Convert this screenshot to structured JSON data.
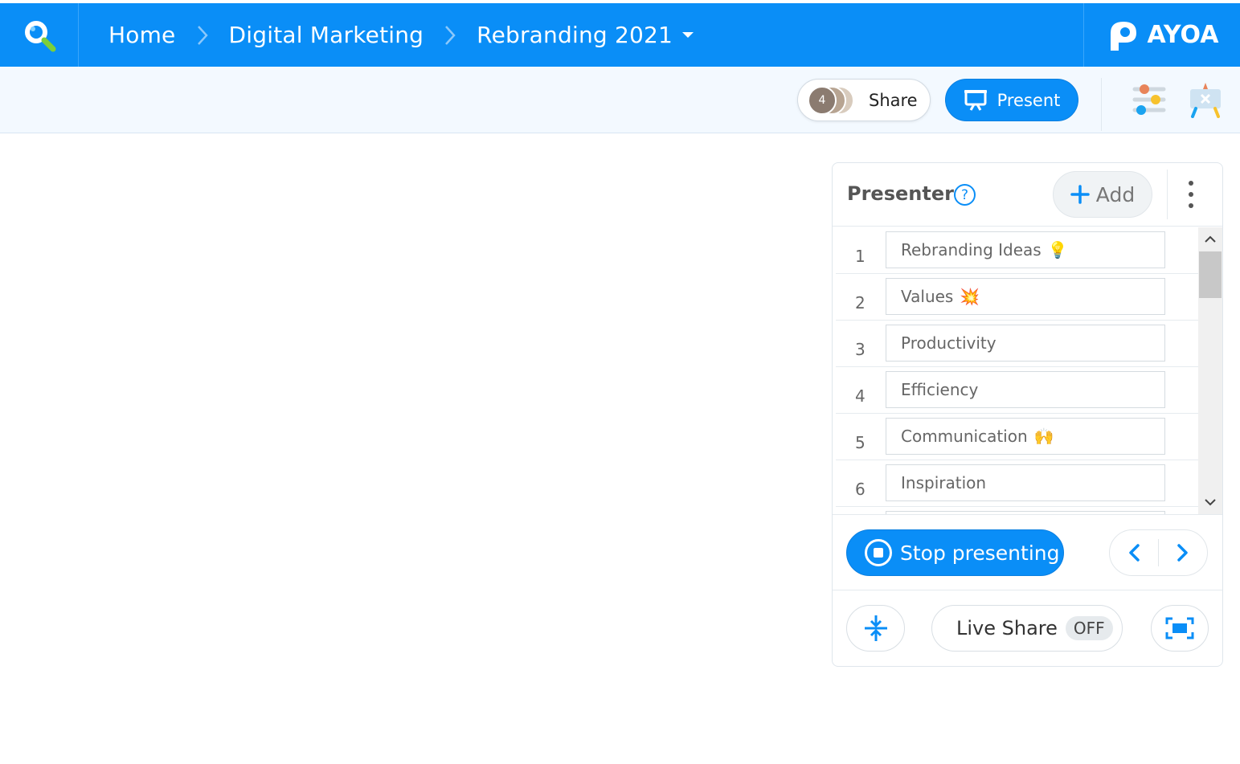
{
  "header": {
    "breadcrumbs": [
      "Home",
      "Digital Marketing",
      "Rebranding 2021"
    ],
    "logo_text": "AYOA",
    "background_color": "#0a8ef7"
  },
  "toolbar": {
    "share_label": "Share",
    "avatar_count": "4",
    "present_label": "Present",
    "icons": [
      "settings-sliders-icon",
      "presentation-board-icon"
    ]
  },
  "presenter": {
    "title": "Presenter",
    "help_label": "?",
    "add_label": "Add",
    "slides": [
      {
        "num": "1",
        "label": "Rebranding Ideas",
        "emoji": "💡"
      },
      {
        "num": "2",
        "label": "Values",
        "emoji": "💥"
      },
      {
        "num": "3",
        "label": "Productivity",
        "emoji": ""
      },
      {
        "num": "4",
        "label": "Efficiency",
        "emoji": ""
      },
      {
        "num": "5",
        "label": "Communication",
        "emoji": "🙌"
      },
      {
        "num": "6",
        "label": "Inspiration",
        "emoji": ""
      }
    ],
    "stop_label": "Stop presenting",
    "live_share_label": "Live Share",
    "live_share_state": "OFF"
  }
}
